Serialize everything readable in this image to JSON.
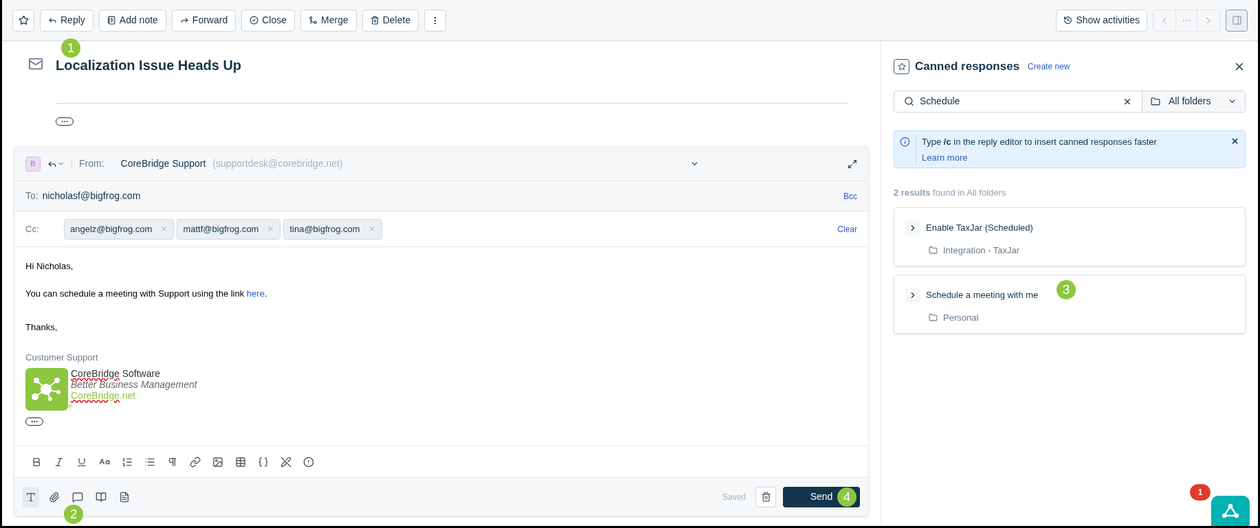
{
  "toolbar": {
    "buttons": [
      "Reply",
      "Add note",
      "Forward",
      "Close",
      "Merge",
      "Delete"
    ],
    "show_activities": "Show activities"
  },
  "ticket": {
    "title": "Localization Issue Heads Up"
  },
  "compose": {
    "avatar": "B",
    "from_label": "From:",
    "from_name": "CoreBridge Support",
    "from_email": "(supportdesk@corebridge.net)",
    "to_label": "To:",
    "to": "nicholasf@bigfrog.com",
    "bcc": "Bcc",
    "cc_label": "Cc:",
    "cc": [
      "angelz@bigfrog.com",
      "mattf@bigfrog.com",
      "tina@bigfrog.com"
    ],
    "clear": "Clear",
    "greeting": "Hi Nicholas,",
    "body_text": "You can schedule a meeting with Support using the link",
    "body_link": "here",
    "body_end": ".",
    "closing": "Thanks,",
    "signature": {
      "name": "Customer Support",
      "company": [
        {
          "text": "CoreBridge",
          "misspelled": true
        },
        {
          "text": " Software",
          "misspelled": false
        }
      ],
      "tagline": "Better Business Management",
      "website": [
        {
          "text": "CoreBridge",
          "misspelled": true
        },
        {
          "text": ".net",
          "misspelled": false
        }
      ],
      "registered": "®"
    },
    "saved": "Saved",
    "send": "Send"
  },
  "canned": {
    "title": "Canned responses",
    "create_new": "Create new",
    "search": "Schedule",
    "folder": "All folders",
    "tip": "Type **/c** in the reply editor to insert canned responses faster",
    "learn_more": "Learn more",
    "results": "**2 results** found in All folders",
    "items": [
      {
        "title": "Enable TaxJar (Scheduled)",
        "folder": "Integration - TaxJar"
      },
      {
        "title": "Schedule a meeting with me",
        "folder": "Personal"
      }
    ]
  },
  "widget": {
    "badge": "1"
  },
  "callouts": [
    "1",
    "2",
    "3",
    "4"
  ]
}
